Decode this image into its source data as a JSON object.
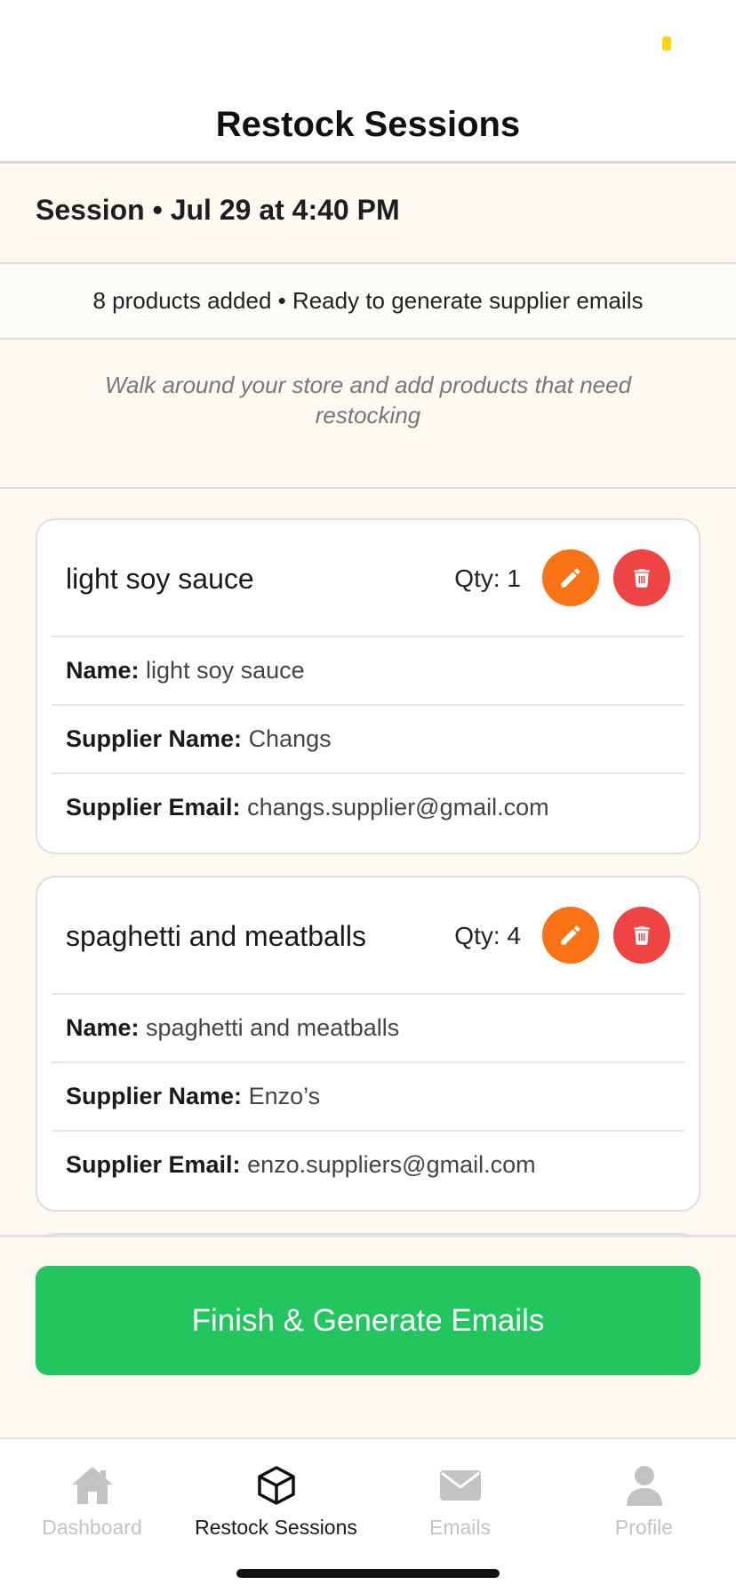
{
  "colors": {
    "accent_green": "#22c55e",
    "edit_orange": "#f97316",
    "delete_red": "#ef4444",
    "panel_cream": "#fdf9f1",
    "status_yellow": "#ffd60a"
  },
  "header": {
    "title": "Restock Sessions"
  },
  "session": {
    "title": "Session • Jul 29 at 4:40 PM",
    "summary": "8 products added • Ready to generate supplier emails",
    "hint": "Walk around your store and add products that need restocking"
  },
  "labels": {
    "name": "Name:",
    "supplier_name": "Supplier Name:",
    "supplier_email": "Supplier Email:"
  },
  "products": [
    {
      "title": "light soy sauce",
      "qty": "Qty: 1",
      "name": "light soy sauce",
      "supplier_name": "Changs",
      "supplier_email": "changs.supplier@gmail.com"
    },
    {
      "title": "spaghetti and meatballs",
      "qty": "Qty: 4",
      "name": "spaghetti and meatballs",
      "supplier_name": "Enzo’s",
      "supplier_email": "enzo.suppliers@gmail.com"
    }
  ],
  "icons": {
    "edit": "pencil-icon",
    "delete": "trash-icon",
    "dashboard": "house-icon",
    "restock": "box-icon",
    "emails": "envelope-icon",
    "profile": "person-icon"
  },
  "actions": {
    "finish": "Finish & Generate Emails"
  },
  "tabs": [
    {
      "label": "Dashboard",
      "active": false
    },
    {
      "label": "Restock Sessions",
      "active": true
    },
    {
      "label": "Emails",
      "active": false
    },
    {
      "label": "Profile",
      "active": false
    }
  ]
}
